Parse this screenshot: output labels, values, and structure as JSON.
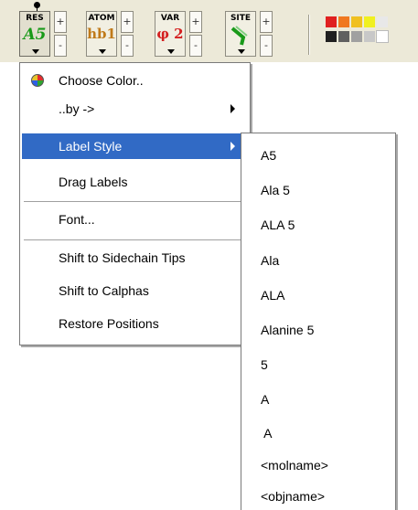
{
  "toolbar": {
    "tools": [
      {
        "tag": "RES",
        "value": "A5",
        "color": "#1a9a1a"
      },
      {
        "tag": "ATOM",
        "value": "hb1",
        "color": "#c07a1a"
      },
      {
        "tag": "VAR",
        "value": "φ 2",
        "color": "#d42020"
      },
      {
        "tag": "SITE",
        "value": "",
        "color": "#1a9a1a"
      }
    ],
    "spinner": {
      "plus": "+",
      "minus": "-"
    },
    "swatches": [
      "#e02020",
      "#f07820",
      "#f0c020",
      "#f0f020",
      "#e8e8e8",
      "#202020",
      "#606060",
      "#a0a0a0",
      "#c8c8c8",
      "#ffffff"
    ]
  },
  "menu": {
    "items": [
      {
        "label": "Choose Color.."
      },
      {
        "label": "..by ->"
      },
      {
        "label": "Label Style"
      },
      {
        "label": "Drag Labels"
      },
      {
        "label": "Font..."
      },
      {
        "label": "Shift to Sidechain Tips"
      },
      {
        "label": "Shift to Calphas"
      },
      {
        "label": "Restore Positions"
      }
    ],
    "selected_color": "#316ac5"
  },
  "submenu": {
    "items": [
      "A5",
      "Ala 5",
      "ALA 5",
      "Ala",
      "ALA",
      "Alanine 5",
      "5",
      "A",
      " A",
      "<molname>",
      "<objname>"
    ]
  }
}
